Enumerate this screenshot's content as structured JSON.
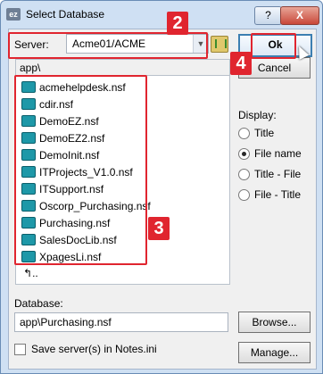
{
  "window": {
    "title": "Select Database",
    "app_icon": "ez",
    "help_label": "?",
    "close_label": "X"
  },
  "server": {
    "label": "Server:",
    "value": "Acme01/ACME"
  },
  "path": "app\\",
  "files": [
    "acmehelpdesk.nsf",
    "cdir.nsf",
    "DemoEZ.nsf",
    "DemoEZ2.nsf",
    "DemoInit.nsf",
    "ITProjects_V1.0.nsf",
    "ITSupport.nsf",
    "Oscorp_Purchasing.nsf",
    "Purchasing.nsf",
    "SalesDocLib.nsf",
    "XpagesLi.nsf"
  ],
  "up_label": "..",
  "buttons": {
    "ok": "Ok",
    "cancel": "Cancel",
    "browse": "Browse...",
    "manage": "Manage..."
  },
  "display": {
    "label": "Display:",
    "options": [
      {
        "label": "Title",
        "selected": false
      },
      {
        "label": "File name",
        "selected": true
      },
      {
        "label": "Title - File",
        "selected": false
      },
      {
        "label": "File - Title",
        "selected": false
      }
    ]
  },
  "database": {
    "label": "Database:",
    "value": "app\\Purchasing.nsf"
  },
  "save_server_label": "Save server(s) in Notes.ini",
  "annotations": {
    "server": "2",
    "files": "3",
    "ok": "4"
  },
  "colors": {
    "annotation": "#e0252f",
    "file_icon": "#1e98a8"
  }
}
